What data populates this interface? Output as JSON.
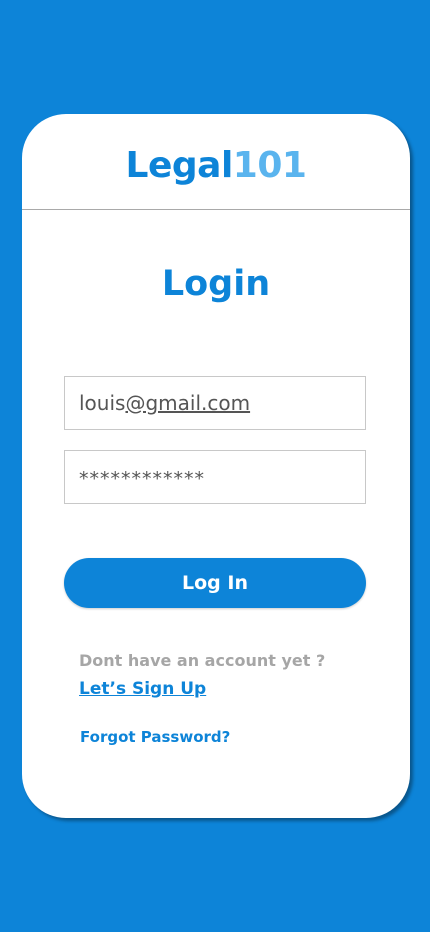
{
  "brand": {
    "part1": "Legal",
    "part2": "101"
  },
  "login": {
    "title": "Login",
    "email": {
      "prefix": "louis",
      "rest": "@gmail.com"
    },
    "password_masked": "************",
    "login_button": "Log In",
    "no_account_text": "Dont have an account yet ?",
    "signup_link": "Let’s Sign Up",
    "forgot_link": "Forgot Password?"
  },
  "colors": {
    "background": "#0d84d8",
    "brand_primary": "#0d84d8",
    "brand_secondary": "#5ab4ee",
    "muted_text": "#a6a6a6"
  }
}
